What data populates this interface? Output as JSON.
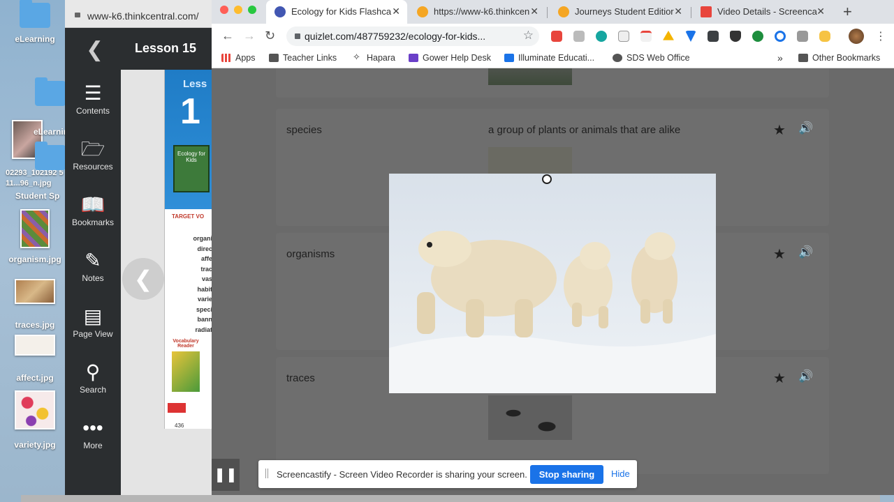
{
  "desktop": {
    "items": [
      {
        "label": "eLearning",
        "type": "folder"
      },
      {
        "label": "eLearning",
        "type": "folder"
      },
      {
        "label": "02293_102192 511...96_n.jpg",
        "type": "image"
      },
      {
        "label": "Student Sp",
        "type": "folder"
      },
      {
        "label": "organism.jpg",
        "type": "image"
      },
      {
        "label": "traces.jpg",
        "type": "image"
      },
      {
        "label": "affect.jpg",
        "type": "image"
      },
      {
        "label": "variety.jpg",
        "type": "image"
      }
    ]
  },
  "thinkcentral": {
    "url": "www-k6.thinkcentral.com/",
    "header": "Lesson 15",
    "sidebar": [
      {
        "label": "Contents",
        "icon": "list-icon"
      },
      {
        "label": "Resources",
        "icon": "folder-plus-icon"
      },
      {
        "label": "Bookmarks",
        "icon": "bookmark-icon"
      },
      {
        "label": "Notes",
        "icon": "pencil-icon"
      },
      {
        "label": "Page View",
        "icon": "page-view-icon"
      },
      {
        "label": "Search",
        "icon": "search-icon"
      },
      {
        "label": "More",
        "icon": "more-icon"
      }
    ],
    "book": {
      "lesson_text": "Less",
      "lesson_num": "1",
      "cover_title": "Ecology for Kids",
      "target_label": "TARGET VO",
      "words": [
        "organi",
        "direc",
        "affe",
        "trac",
        "vas",
        "habit",
        "varie",
        "speci",
        "bann",
        "radiat"
      ],
      "vocab_label": "Vocabulary Reader",
      "page_number": "436"
    }
  },
  "browser": {
    "tabs": [
      {
        "title": "Ecology for Kids Flashca",
        "active": true,
        "favicon_color": "#4257b2"
      },
      {
        "title": "https://www-k6.thinkcen",
        "active": false,
        "favicon_color": "#f5a623"
      },
      {
        "title": "Journeys Student Editior",
        "active": false,
        "favicon_color": "#f5a623"
      },
      {
        "title": "Video Details - Screenca",
        "active": false,
        "favicon_color": "#e8453c"
      }
    ],
    "url": "quizlet.com/487759232/ecology-for-kids...",
    "bookmarks": [
      {
        "label": "Apps",
        "color": "#e8453c"
      },
      {
        "label": "Teacher Links",
        "color": "#555"
      },
      {
        "label": "Hapara",
        "color": "#333"
      },
      {
        "label": "Gower Help Desk",
        "color": "#6a3fc8"
      },
      {
        "label": "Illuminate Educati...",
        "color": "#1a73e8"
      },
      {
        "label": "SDS Web Office",
        "color": "#555"
      }
    ],
    "overflow": "»",
    "other_bookmarks": "Other Bookmarks"
  },
  "quizlet": {
    "cards": [
      {
        "term": "",
        "definition": ""
      },
      {
        "term": "species",
        "definition": "a group of plants or animals that are alike"
      },
      {
        "term": "organisms",
        "definition": ""
      },
      {
        "term": "traces",
        "definition": ""
      }
    ]
  },
  "share_bar": {
    "message": "Screencastify - Screen Video Recorder is sharing your screen.",
    "stop_label": "Stop sharing",
    "hide_label": "Hide"
  }
}
